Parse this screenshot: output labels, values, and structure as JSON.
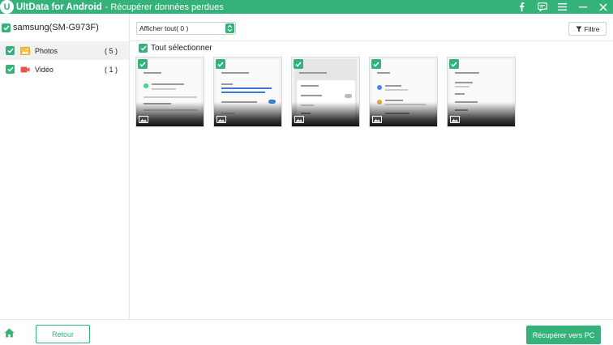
{
  "app": {
    "logo_letter": "U",
    "name": "UltData for Android",
    "separator_subtitle": "- Récupérer données perdues",
    "brand_color": "#35b27a"
  },
  "titlebar_icons": [
    "facebook-icon",
    "feedback-icon",
    "menu-icon",
    "minimize-icon",
    "close-icon"
  ],
  "sidebar": {
    "device": "samsung(SM-G973F)",
    "categories": [
      {
        "label": "Photos",
        "count": "( 5 )",
        "icon": "photo-icon",
        "selected": true,
        "checked": true
      },
      {
        "label": "Vidéo",
        "count": "( 1 )",
        "icon": "video-icon",
        "selected": false,
        "checked": true
      }
    ]
  },
  "toolbar": {
    "dropdown_value": "Afficher tout( 0 )",
    "filter_label": "Filtre"
  },
  "main": {
    "select_all_label": "Tout sélectionner",
    "thumbnails": [
      {
        "checked": true,
        "icon": "image-icon"
      },
      {
        "checked": true,
        "icon": "image-icon"
      },
      {
        "checked": true,
        "icon": "image-icon"
      },
      {
        "checked": true,
        "icon": "image-icon"
      },
      {
        "checked": true,
        "icon": "image-icon"
      }
    ]
  },
  "footer": {
    "back_label": "Retour",
    "recover_label": "Récupérer vers PC"
  }
}
